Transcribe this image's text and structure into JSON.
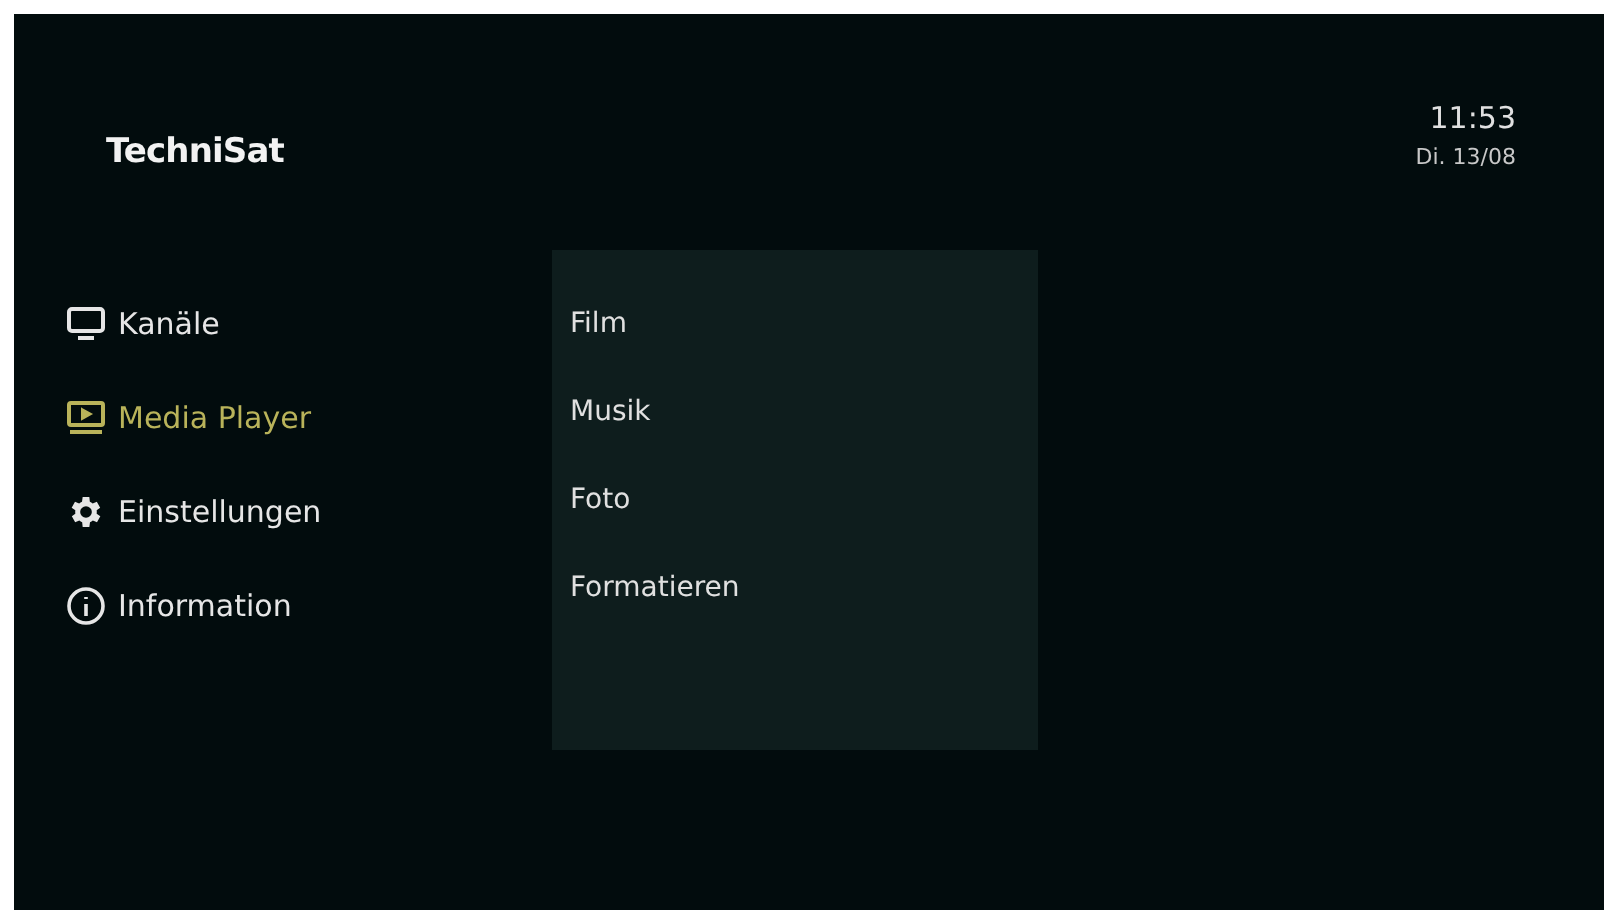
{
  "brand": "TechniSat",
  "clock": {
    "time": "11:53",
    "date": "Di. 13/08"
  },
  "menu": [
    {
      "kind": "tv",
      "label": "Kanäle",
      "selected": false
    },
    {
      "kind": "media",
      "label": "Media Player",
      "selected": true
    },
    {
      "kind": "gear",
      "label": "Einstellungen",
      "selected": false
    },
    {
      "kind": "info",
      "label": "Information",
      "selected": false
    }
  ],
  "submenu": [
    {
      "label": "Film"
    },
    {
      "label": "Musik"
    },
    {
      "label": "Foto"
    },
    {
      "label": "Formatieren"
    }
  ]
}
